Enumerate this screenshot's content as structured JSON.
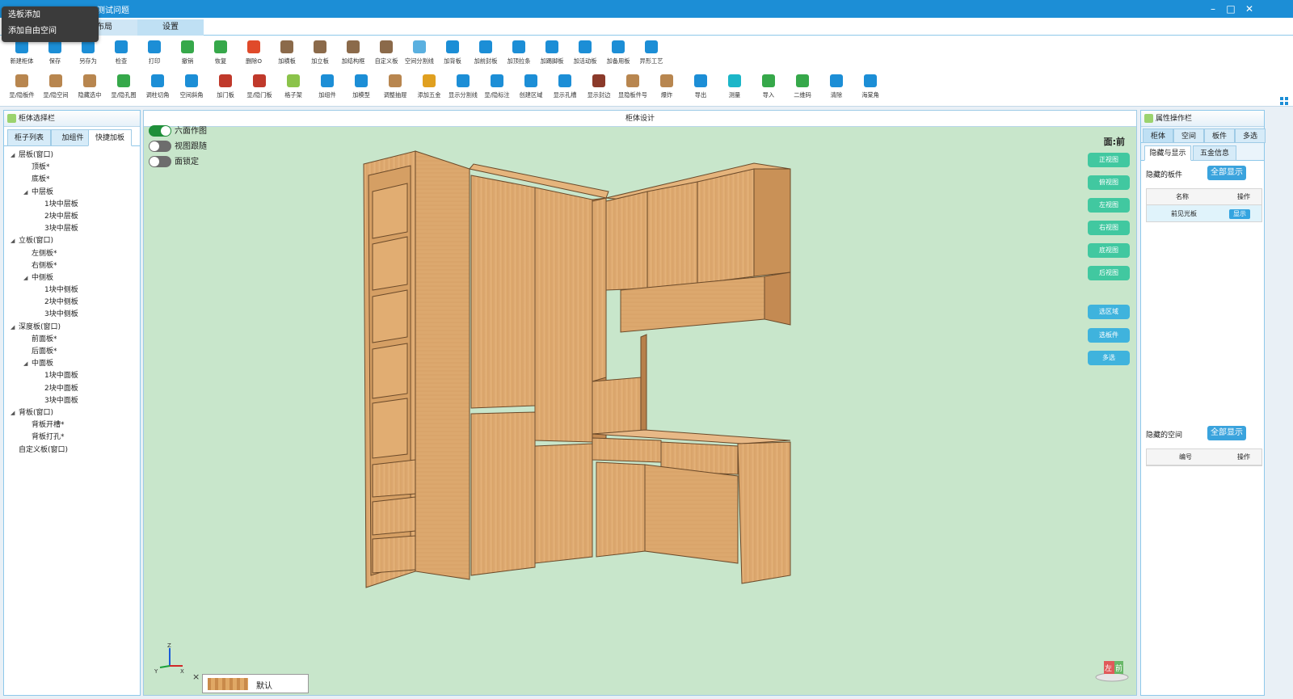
{
  "window": {
    "title": "测试问题",
    "controls": [
      "–",
      "□",
      "✕"
    ]
  },
  "popup": {
    "items": [
      "选板添加",
      "添加自由空间"
    ]
  },
  "tabs": [
    {
      "label": "布局"
    },
    {
      "label": "设置"
    }
  ],
  "toolbar": {
    "row1": [
      {
        "label": "新建柜体",
        "icon": "new-cabinet-icon",
        "color": "#1c8ed6"
      },
      {
        "label": "保存",
        "icon": "save-icon",
        "color": "#1c8ed6"
      },
      {
        "label": "另存为",
        "icon": "save-as-icon",
        "color": "#1c8ed6"
      },
      {
        "label": "检查",
        "icon": "check-icon",
        "color": "#1c8ed6"
      },
      {
        "label": "打印",
        "icon": "print-icon",
        "color": "#1c8ed6"
      },
      {
        "label": "撤销",
        "icon": "undo-icon",
        "color": "#36a84a"
      },
      {
        "label": "恢复",
        "icon": "redo-icon",
        "color": "#36a84a"
      },
      {
        "label": "删除O",
        "icon": "delete-icon",
        "color": "#e04a2a"
      },
      {
        "label": "加横板",
        "icon": "add-horizontal-board-icon",
        "color": "#8b6a4a"
      },
      {
        "label": "加立板",
        "icon": "add-vertical-board-icon",
        "color": "#8b6a4a"
      },
      {
        "label": "加结构框",
        "icon": "add-frame-icon",
        "color": "#8b6a4a"
      },
      {
        "label": "自定义板",
        "icon": "custom-board-icon",
        "color": "#8b6a4a"
      },
      {
        "label": "空间分割线",
        "icon": "split-line-icon",
        "color": "#5ab0e0"
      },
      {
        "label": "加背板",
        "icon": "add-back-board-icon",
        "color": "#1c8ed6"
      },
      {
        "label": "加前封板",
        "icon": "add-front-board-icon",
        "color": "#1c8ed6"
      },
      {
        "label": "加顶拉条",
        "icon": "add-top-strip-icon",
        "color": "#1c8ed6"
      },
      {
        "label": "加踢脚板",
        "icon": "add-kickboard-icon",
        "color": "#1c8ed6"
      },
      {
        "label": "加活动板",
        "icon": "add-movable-board-icon",
        "color": "#1c8ed6"
      },
      {
        "label": "加备用板",
        "icon": "add-spare-board-icon",
        "color": "#1c8ed6"
      },
      {
        "label": "异形工艺",
        "icon": "special-shape-icon",
        "color": "#1c8ed6"
      }
    ],
    "row2": [
      {
        "label": "显/隐板件",
        "icon": "toggle-board-icon",
        "color": "#b8864f"
      },
      {
        "label": "显/隐空间",
        "icon": "toggle-space-icon",
        "color": "#b8864f"
      },
      {
        "label": "隐藏选中",
        "icon": "hide-selected-icon",
        "color": "#b8864f"
      },
      {
        "label": "显/隐孔图",
        "icon": "toggle-holes-icon",
        "color": "#36a84a"
      },
      {
        "label": "调柱切角",
        "icon": "pillar-cut-icon",
        "color": "#1c8ed6"
      },
      {
        "label": "空间斜角",
        "icon": "space-bevel-icon",
        "color": "#1c8ed6"
      },
      {
        "label": "加门板",
        "icon": "add-door-icon",
        "color": "#c0392b"
      },
      {
        "label": "显/隐门板",
        "icon": "toggle-door-icon",
        "color": "#c0392b"
      },
      {
        "label": "格子架",
        "icon": "grid-rack-icon",
        "color": "#8bc34a"
      },
      {
        "label": "加组件",
        "icon": "add-component-icon",
        "color": "#1c8ed6"
      },
      {
        "label": "加模型",
        "icon": "add-model-icon",
        "color": "#1c8ed6"
      },
      {
        "label": "调整抽屉",
        "icon": "adjust-drawer-icon",
        "color": "#b8864f"
      },
      {
        "label": "添加五金",
        "icon": "add-hardware-icon",
        "color": "#e0a020"
      },
      {
        "label": "显示分割线",
        "icon": "show-split-icon",
        "color": "#1c8ed6"
      },
      {
        "label": "显/隐标注",
        "icon": "toggle-dimension-icon",
        "color": "#1c8ed6"
      },
      {
        "label": "创建区域",
        "icon": "create-area-icon",
        "color": "#1c8ed6"
      },
      {
        "label": "显示孔槽",
        "icon": "show-slots-icon",
        "color": "#1c8ed6"
      },
      {
        "label": "显示封边",
        "icon": "show-edge-icon",
        "color": "#8b3a2a"
      },
      {
        "label": "显隐板件号",
        "icon": "board-number-icon",
        "color": "#b8864f"
      },
      {
        "label": "爆炸",
        "icon": "explode-icon",
        "color": "#b8864f"
      },
      {
        "label": "导出",
        "icon": "export-icon",
        "color": "#1c8ed6"
      },
      {
        "label": "测量",
        "icon": "measure-icon",
        "color": "#1cb6c8"
      },
      {
        "label": "导入",
        "icon": "import-icon",
        "color": "#36a84a"
      },
      {
        "label": "二维码",
        "icon": "qrcode-icon",
        "color": "#36a84a"
      },
      {
        "label": "清除",
        "icon": "clear-icon",
        "color": "#1c8ed6"
      },
      {
        "label": "海棠角",
        "icon": "corner-icon",
        "color": "#1c8ed6"
      }
    ]
  },
  "left_panel": {
    "title": "柜体选择栏",
    "tabs": [
      "柜子列表",
      "加组件",
      "快捷加板"
    ],
    "tree": [
      {
        "label": "层板(窗口)",
        "level": 0,
        "expanded": true
      },
      {
        "label": "顶板*",
        "level": 1
      },
      {
        "label": "底板*",
        "level": 1
      },
      {
        "label": "中层板",
        "level": 1,
        "expanded": true
      },
      {
        "label": "1块中层板",
        "level": 2
      },
      {
        "label": "2块中层板",
        "level": 2
      },
      {
        "label": "3块中层板",
        "level": 2
      },
      {
        "label": "立板(窗口)",
        "level": 0,
        "expanded": true
      },
      {
        "label": "左侧板*",
        "level": 1
      },
      {
        "label": "右侧板*",
        "level": 1
      },
      {
        "label": "中侧板",
        "level": 1,
        "expanded": true
      },
      {
        "label": "1块中侧板",
        "level": 2
      },
      {
        "label": "2块中侧板",
        "level": 2
      },
      {
        "label": "3块中侧板",
        "level": 2
      },
      {
        "label": "深度板(窗口)",
        "level": 0,
        "expanded": true
      },
      {
        "label": "前面板*",
        "level": 1
      },
      {
        "label": "后面板*",
        "level": 1
      },
      {
        "label": "中面板",
        "level": 1,
        "expanded": true
      },
      {
        "label": "1块中面板",
        "level": 2
      },
      {
        "label": "2块中面板",
        "level": 2
      },
      {
        "label": "3块中面板",
        "level": 2
      },
      {
        "label": "背板(窗口)",
        "level": 0,
        "expanded": true
      },
      {
        "label": "背板开槽*",
        "level": 1
      },
      {
        "label": "背板打孔*",
        "level": 1
      },
      {
        "label": "自定义板(窗口)",
        "level": 0
      }
    ]
  },
  "viewport": {
    "title": "柜体设计",
    "toggles": [
      {
        "label": "六面作图",
        "on": true
      },
      {
        "label": "视图跟随",
        "on": false
      },
      {
        "label": "面锁定",
        "on": false
      }
    ],
    "face_label": "面:前",
    "view_buttons": [
      "正视图",
      "俯视图",
      "左视图",
      "右视图",
      "底视图",
      "后视图"
    ],
    "select_buttons": [
      "选区域",
      "选板件",
      "多选"
    ],
    "material": {
      "name": "默认",
      "close": "×"
    },
    "axis": {
      "z": "Z",
      "y": "Y",
      "x": "X"
    },
    "cube_labels": [
      "左",
      "前"
    ]
  },
  "right_panel": {
    "title": "属性操作栏",
    "tabs": [
      "柜体",
      "空间",
      "板件",
      "多选"
    ],
    "sub_tabs": [
      "隐藏与显示",
      "五金信息"
    ],
    "hidden_boards": {
      "label": "隐藏的板件",
      "show_all": "全部显示",
      "columns": [
        "名称",
        "操作"
      ],
      "rows": [
        {
          "name": "前见光板",
          "action": "显示"
        }
      ]
    },
    "hidden_spaces": {
      "label": "隐藏的空间",
      "show_all": "全部显示",
      "columns": [
        "编号",
        "操作"
      ],
      "rows": []
    }
  }
}
